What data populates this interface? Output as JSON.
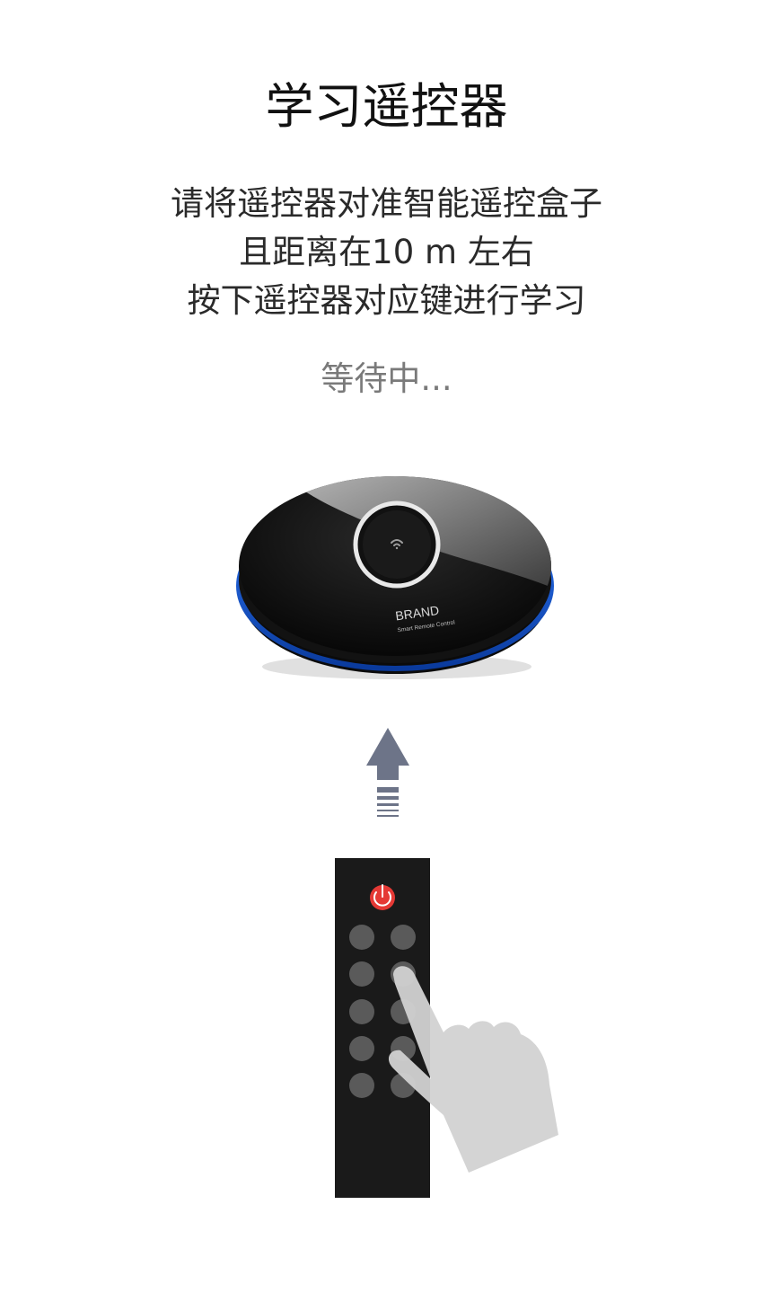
{
  "page": {
    "title": "学习遥控器",
    "instructions": [
      "请将遥控器对准智能遥控盒子",
      "且距离在10 m 左右",
      "按下遥控器对应键进行学习"
    ],
    "status": "等待中..."
  },
  "device": {
    "brand": "BRAND",
    "subtitle": "Smart Remote Control",
    "icon": "wifi-signal-icon",
    "accent_color": "#1f6bff"
  },
  "graphics": {
    "arrow_icon": "up-arrow-icon",
    "remote_icon": "ir-remote-icon",
    "hand_icon": "pointing-hand-icon",
    "power_color": "#e53935"
  }
}
